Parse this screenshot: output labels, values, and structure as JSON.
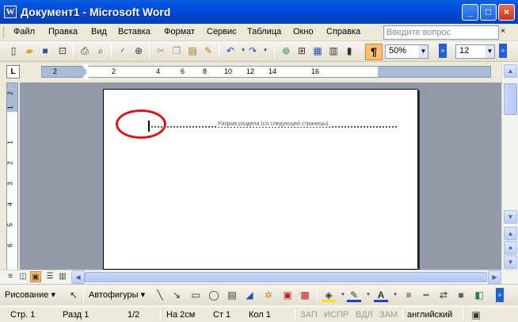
{
  "window": {
    "title": "Документ1 - Microsoft Word",
    "app_icon": "W",
    "controls": {
      "minimize": "_",
      "maximize": "□",
      "close": "×"
    }
  },
  "menu": {
    "items": [
      "Файл",
      "Правка",
      "Вид",
      "Вставка",
      "Формат",
      "Сервис",
      "Таблица",
      "Окно",
      "Справка"
    ],
    "help_placeholder": "Введите вопрос",
    "close_doc": "×"
  },
  "toolbar": {
    "pilcrow": "¶",
    "zoom": "50%",
    "font_size": "12"
  },
  "ruler": {
    "numbers": [
      "2",
      "2",
      "4",
      "6",
      "8",
      "10",
      "12",
      "14",
      "16"
    ],
    "vertical_numbers": [
      "2",
      "1",
      "1",
      "2",
      "3",
      "4",
      "5",
      "6"
    ]
  },
  "document": {
    "section_break_label": "Разрыв раздела (со следующей страницы)"
  },
  "drawing": {
    "draw_menu": "Рисование ▾",
    "autoshapes": "Автофигуры ▾"
  },
  "status": {
    "page": "Стр. 1",
    "section": "Разд 1",
    "page_of": "1/2",
    "at": "На 2см",
    "line": "Ст 1",
    "column": "Кол 1",
    "rec": "ЗАП",
    "track": "ИСПР",
    "ext": "ВДЛ",
    "ovr": "ЗАМ",
    "language": "английский"
  },
  "colors": {
    "title_bar": "#0050E0",
    "highlight_ring": "#D8141C",
    "workspace": "#909AA8",
    "ruler": "#A9BCD6",
    "active_toggle": "#FFC070"
  }
}
